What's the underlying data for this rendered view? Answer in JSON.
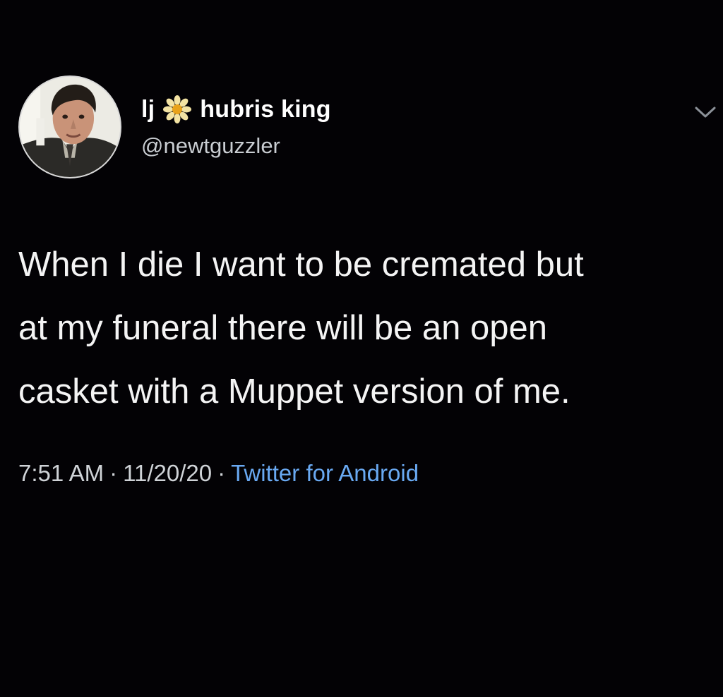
{
  "tweet": {
    "author": {
      "display_name_prefix": "lj",
      "display_name_emoji": "flower-icon",
      "display_name": "hubris king",
      "handle": "@newtguzzler"
    },
    "text_lines": [
      "When I die I want to be cremated but",
      "at my funeral there will be an open",
      "casket with a Muppet version of me."
    ],
    "time": "7:51 AM",
    "separator": "·",
    "date": "11/20/20",
    "client": "Twitter for Android"
  },
  "colors": {
    "background": "#030205",
    "text": "#f4f4f4",
    "secondary_text": "#c9cdd2",
    "link": "#69a9f2"
  }
}
